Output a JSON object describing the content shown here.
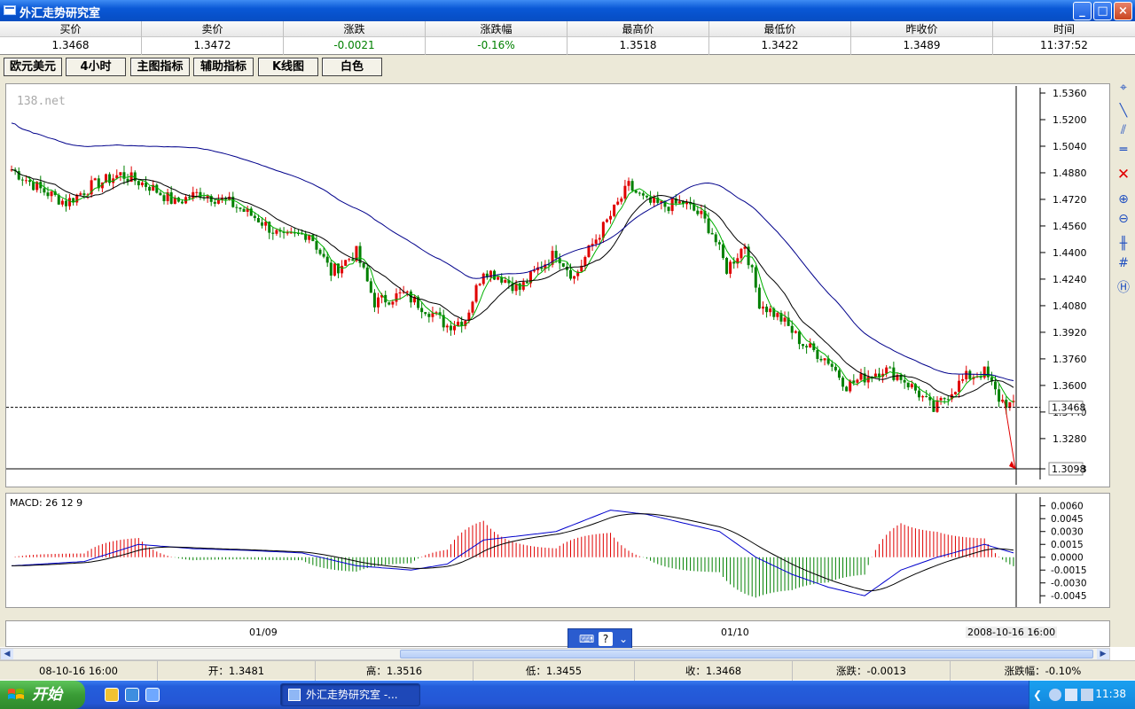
{
  "window": {
    "title": "外汇走势研究室",
    "minimize": "_",
    "maximize": "□",
    "close": "×"
  },
  "quote": {
    "headers": [
      "买价",
      "卖价",
      "涨跌",
      "涨跌幅",
      "最高价",
      "最低价",
      "昨收价",
      "时间"
    ],
    "values": [
      "1.3468",
      "1.3472",
      "-0.0021",
      "-0.16%",
      "1.3518",
      "1.3422",
      "1.3489",
      "11:37:52"
    ]
  },
  "toolbar": {
    "buttons": [
      "欧元美元",
      "4小时",
      "主图指标",
      "辅助指标",
      "K线图",
      "白色"
    ]
  },
  "main_chart": {
    "watermark": "138.net",
    "y_ticks": [
      "1.5360",
      "1.5200",
      "1.5040",
      "1.4880",
      "1.4720",
      "1.4560",
      "1.4400",
      "1.4240",
      "1.4080",
      "1.3920",
      "1.3760",
      "1.3600",
      "1.3440",
      "1.3280",
      "1.3098"
    ],
    "current_price_label": "1.3468",
    "bottom_price_label": "1.3098",
    "colors": {
      "up": "#e00000",
      "down": "#008000",
      "ma_fast": "#00b000",
      "ma_mid": "#000000",
      "ma_slow": "#00008b",
      "arrow": "#e00000"
    }
  },
  "macd": {
    "label": "MACD: 26 12 9",
    "y_ticks": [
      "0.0060",
      "0.0045",
      "0.0030",
      "0.0015",
      "0.0000",
      "-0.0015",
      "-0.0030",
      "-0.0045"
    ]
  },
  "time_axis": {
    "labels": [
      "01/09",
      "01/10",
      "2008-10-16 16:00"
    ]
  },
  "status": {
    "date": "08-10-16 16:00",
    "open": "开：1.3481",
    "high": "高：1.3516",
    "low": "低：1.3455",
    "close": "收：1.3468",
    "change": "涨跌：-0.0013",
    "change_pct": "涨跌幅：-0.10%"
  },
  "taskbar": {
    "start": "开始",
    "task": "外汇走势研究室 -...",
    "clock": "11:38"
  },
  "chart_data": {
    "type": "candlestick",
    "series": "EUR/USD 4H",
    "ylim": [
      1.3098,
      1.536
    ],
    "macd_ylim": [
      -0.0052,
      0.0068
    ],
    "anchors": [
      [
        0,
        1.49
      ],
      [
        8,
        1.478
      ],
      [
        15,
        1.47
      ],
      [
        22,
        1.48
      ],
      [
        30,
        1.487
      ],
      [
        38,
        1.48
      ],
      [
        45,
        1.47
      ],
      [
        52,
        1.476
      ],
      [
        60,
        1.47
      ],
      [
        68,
        1.46
      ],
      [
        75,
        1.448
      ],
      [
        82,
        1.452
      ],
      [
        88,
        1.428
      ],
      [
        95,
        1.44
      ],
      [
        100,
        1.41
      ],
      [
        108,
        1.415
      ],
      [
        115,
        1.405
      ],
      [
        120,
        1.396
      ],
      [
        125,
        1.4
      ],
      [
        130,
        1.43
      ],
      [
        135,
        1.425
      ],
      [
        140,
        1.418
      ],
      [
        145,
        1.43
      ],
      [
        150,
        1.44
      ],
      [
        155,
        1.425
      ],
      [
        160,
        1.445
      ],
      [
        165,
        1.462
      ],
      [
        170,
        1.48
      ],
      [
        175,
        1.47
      ],
      [
        180,
        1.468
      ],
      [
        185,
        1.47
      ],
      [
        190,
        1.462
      ],
      [
        193,
        1.452
      ],
      [
        197,
        1.43
      ],
      [
        202,
        1.445
      ],
      [
        206,
        1.41
      ],
      [
        212,
        1.4
      ],
      [
        218,
        1.385
      ],
      [
        225,
        1.375
      ],
      [
        230,
        1.36
      ],
      [
        235,
        1.365
      ],
      [
        240,
        1.37
      ],
      [
        245,
        1.365
      ],
      [
        250,
        1.355
      ],
      [
        254,
        1.345
      ],
      [
        258,
        1.355
      ],
      [
        263,
        1.365
      ],
      [
        268,
        1.368
      ],
      [
        272,
        1.352
      ],
      [
        276,
        1.347
      ]
    ],
    "macd_anchors": [
      [
        0,
        -0.001
      ],
      [
        20,
        -0.0005
      ],
      [
        35,
        0.0015
      ],
      [
        50,
        0.001
      ],
      [
        65,
        0.0008
      ],
      [
        80,
        0.0005
      ],
      [
        95,
        -0.001
      ],
      [
        110,
        -0.0015
      ],
      [
        120,
        -0.0008
      ],
      [
        130,
        0.002
      ],
      [
        140,
        0.0025
      ],
      [
        150,
        0.003
      ],
      [
        165,
        0.0055
      ],
      [
        175,
        0.005
      ],
      [
        195,
        0.003
      ],
      [
        205,
        0.0
      ],
      [
        215,
        -0.002
      ],
      [
        225,
        -0.0035
      ],
      [
        235,
        -0.0045
      ],
      [
        245,
        -0.0015
      ],
      [
        255,
        0.0
      ],
      [
        268,
        0.0015
      ],
      [
        276,
        0.0005
      ]
    ]
  }
}
